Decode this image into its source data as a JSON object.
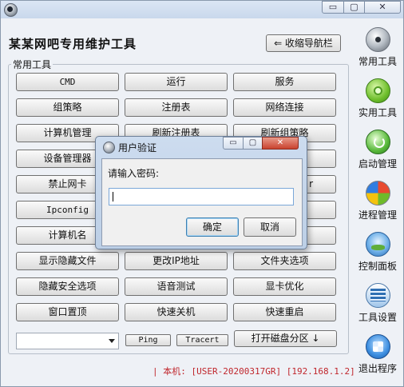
{
  "window": {
    "title": "某某网吧专用维护工具",
    "controls": {
      "minimize": "▭",
      "maximize": "▢",
      "close": "✕"
    }
  },
  "header": {
    "collapse_label": "⇐ 收缩导航栏"
  },
  "tools": {
    "group_label": "常用工具",
    "rows": [
      [
        "CMD",
        "运行",
        "服务"
      ],
      [
        "组策略",
        "注册表",
        "网络连接"
      ],
      [
        "计算机管理",
        "刷新注册表",
        "刷新组策略"
      ],
      [
        "设备管理器",
        "",
        ""
      ],
      [
        "禁止网卡",
        "",
        "r"
      ],
      [
        "Ipconfig",
        "",
        ""
      ],
      [
        "计算机名",
        "",
        ""
      ],
      [
        "显示隐藏文件",
        "更改IP地址",
        "文件夹选项"
      ],
      [
        "隐藏安全选项",
        "语音测试",
        "显卡优化"
      ],
      [
        "窗口置顶",
        "快速关机",
        "快速重启"
      ]
    ],
    "combo_value": "",
    "ping_label": "Ping",
    "tracert_label": "Tracert",
    "disk_label": "打开磁盘分区 ↓"
  },
  "status": {
    "text": "| 本机: [USER-20200317GR]  [192.168.1.2]",
    "color": "#c0262c"
  },
  "sidebar": {
    "items": [
      {
        "label": "常用工具",
        "icon": "cd-disc-icon"
      },
      {
        "label": "实用工具",
        "icon": "gear-icon"
      },
      {
        "label": "启动管理",
        "icon": "power-icon"
      },
      {
        "label": "进程管理",
        "icon": "windows-logo-icon"
      },
      {
        "label": "控制面板",
        "icon": "control-panel-icon"
      },
      {
        "label": "工具设置",
        "icon": "tools-settings-icon"
      },
      {
        "label": "退出程序",
        "icon": "exit-icon"
      }
    ]
  },
  "dialog": {
    "title": "用户验证",
    "prompt": "请输入密码:",
    "password_value": "",
    "ok_label": "确定",
    "cancel_label": "取消",
    "controls": {
      "minimize": "▭",
      "maximize": "▢",
      "close": "✕"
    }
  }
}
